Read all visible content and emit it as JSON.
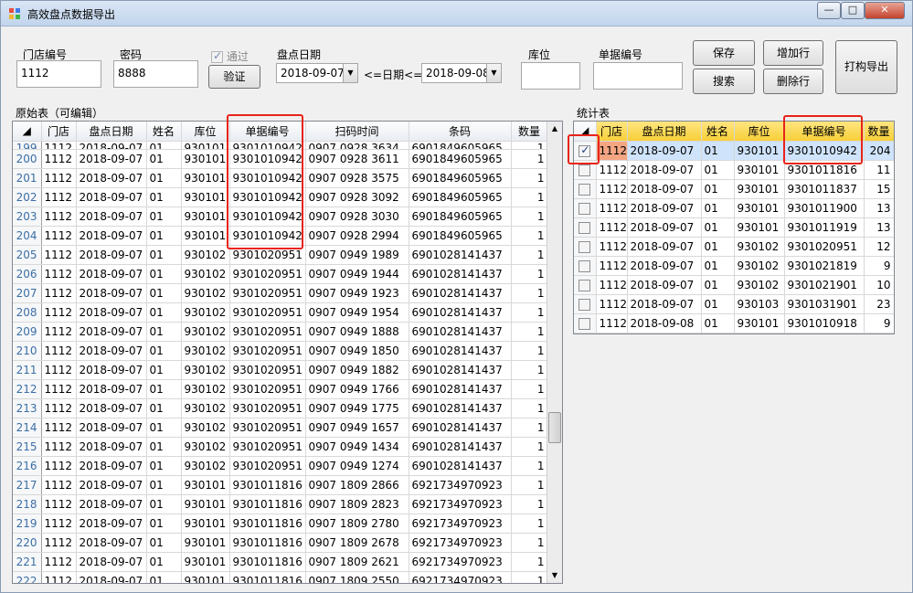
{
  "window": {
    "title": "高效盘点数据导出",
    "min": "—",
    "max": "□",
    "close": "✕"
  },
  "fields": {
    "store_label": "门店编号",
    "store_value": "1112",
    "pwd_label": "密码",
    "pwd_value": "8888",
    "pass_label": "通过",
    "verify": "验证",
    "date_label": "盘点日期",
    "date_from": "2018-09-07",
    "date_sep": "<=日期<=",
    "date_to": "2018-09-08",
    "loc_label": "库位",
    "loc_value": "",
    "doc_label": "单据编号",
    "doc_value": ""
  },
  "buttons": {
    "save": "保存",
    "search": "搜索",
    "add": "增加行",
    "delete": "删除行",
    "print": "打构导出"
  },
  "left": {
    "title": "原始表（可编辑）",
    "cols": [
      "门店",
      "盘点日期",
      "姓名",
      "库位",
      "单据编号",
      "扫码时间",
      "条码",
      "数量"
    ],
    "rows": [
      [
        "199",
        "1112",
        "2018-09-07",
        "01",
        "930101",
        "9301010942",
        "0907 0928 3634",
        "6901849605965",
        "1"
      ],
      [
        "200",
        "1112",
        "2018-09-07",
        "01",
        "930101",
        "9301010942",
        "0907 0928 3611",
        "6901849605965",
        "1"
      ],
      [
        "201",
        "1112",
        "2018-09-07",
        "01",
        "930101",
        "9301010942",
        "0907 0928 3575",
        "6901849605965",
        "1"
      ],
      [
        "202",
        "1112",
        "2018-09-07",
        "01",
        "930101",
        "9301010942",
        "0907 0928 3092",
        "6901849605965",
        "1"
      ],
      [
        "203",
        "1112",
        "2018-09-07",
        "01",
        "930101",
        "9301010942",
        "0907 0928 3030",
        "6901849605965",
        "1"
      ],
      [
        "204",
        "1112",
        "2018-09-07",
        "01",
        "930101",
        "9301010942",
        "0907 0928 2994",
        "6901849605965",
        "1"
      ],
      [
        "205",
        "1112",
        "2018-09-07",
        "01",
        "930102",
        "9301020951",
        "0907 0949 1989",
        "6901028141437",
        "1"
      ],
      [
        "206",
        "1112",
        "2018-09-07",
        "01",
        "930102",
        "9301020951",
        "0907 0949 1944",
        "6901028141437",
        "1"
      ],
      [
        "207",
        "1112",
        "2018-09-07",
        "01",
        "930102",
        "9301020951",
        "0907 0949 1923",
        "6901028141437",
        "1"
      ],
      [
        "208",
        "1112",
        "2018-09-07",
        "01",
        "930102",
        "9301020951",
        "0907 0949 1954",
        "6901028141437",
        "1"
      ],
      [
        "209",
        "1112",
        "2018-09-07",
        "01",
        "930102",
        "9301020951",
        "0907 0949 1888",
        "6901028141437",
        "1"
      ],
      [
        "210",
        "1112",
        "2018-09-07",
        "01",
        "930102",
        "9301020951",
        "0907 0949 1850",
        "6901028141437",
        "1"
      ],
      [
        "211",
        "1112",
        "2018-09-07",
        "01",
        "930102",
        "9301020951",
        "0907 0949 1882",
        "6901028141437",
        "1"
      ],
      [
        "212",
        "1112",
        "2018-09-07",
        "01",
        "930102",
        "9301020951",
        "0907 0949 1766",
        "6901028141437",
        "1"
      ],
      [
        "213",
        "1112",
        "2018-09-07",
        "01",
        "930102",
        "9301020951",
        "0907 0949 1775",
        "6901028141437",
        "1"
      ],
      [
        "214",
        "1112",
        "2018-09-07",
        "01",
        "930102",
        "9301020951",
        "0907 0949 1657",
        "6901028141437",
        "1"
      ],
      [
        "215",
        "1112",
        "2018-09-07",
        "01",
        "930102",
        "9301020951",
        "0907 0949 1434",
        "6901028141437",
        "1"
      ],
      [
        "216",
        "1112",
        "2018-09-07",
        "01",
        "930102",
        "9301020951",
        "0907 0949 1274",
        "6901028141437",
        "1"
      ],
      [
        "217",
        "1112",
        "2018-09-07",
        "01",
        "930101",
        "9301011816",
        "0907 1809 2866",
        "6921734970923",
        "1"
      ],
      [
        "218",
        "1112",
        "2018-09-07",
        "01",
        "930101",
        "9301011816",
        "0907 1809 2823",
        "6921734970923",
        "1"
      ],
      [
        "219",
        "1112",
        "2018-09-07",
        "01",
        "930101",
        "9301011816",
        "0907 1809 2780",
        "6921734970923",
        "1"
      ],
      [
        "220",
        "1112",
        "2018-09-07",
        "01",
        "930101",
        "9301011816",
        "0907 1809 2678",
        "6921734970923",
        "1"
      ],
      [
        "221",
        "1112",
        "2018-09-07",
        "01",
        "930101",
        "9301011816",
        "0907 1809 2621",
        "6921734970923",
        "1"
      ],
      [
        "222",
        "1112",
        "2018-09-07",
        "01",
        "930101",
        "9301011816",
        "0907 1809 2550",
        "6921734970923",
        "1"
      ]
    ]
  },
  "right": {
    "title": "统计表",
    "cols": [
      "门店",
      "盘点日期",
      "姓名",
      "库位",
      "单据编号",
      "数量"
    ],
    "rows": [
      [
        "1112",
        "2018-09-07",
        "01",
        "930101",
        "9301010942",
        "204"
      ],
      [
        "1112",
        "2018-09-07",
        "01",
        "930101",
        "9301011816",
        "11"
      ],
      [
        "1112",
        "2018-09-07",
        "01",
        "930101",
        "9301011837",
        "15"
      ],
      [
        "1112",
        "2018-09-07",
        "01",
        "930101",
        "9301011900",
        "13"
      ],
      [
        "1112",
        "2018-09-07",
        "01",
        "930101",
        "9301011919",
        "13"
      ],
      [
        "1112",
        "2018-09-07",
        "01",
        "930102",
        "9301020951",
        "12"
      ],
      [
        "1112",
        "2018-09-07",
        "01",
        "930102",
        "9301021819",
        "9"
      ],
      [
        "1112",
        "2018-09-07",
        "01",
        "930102",
        "9301021901",
        "10"
      ],
      [
        "1112",
        "2018-09-07",
        "01",
        "930103",
        "9301031901",
        "23"
      ],
      [
        "1112",
        "2018-09-08",
        "01",
        "930101",
        "9301010918",
        "9"
      ]
    ]
  }
}
